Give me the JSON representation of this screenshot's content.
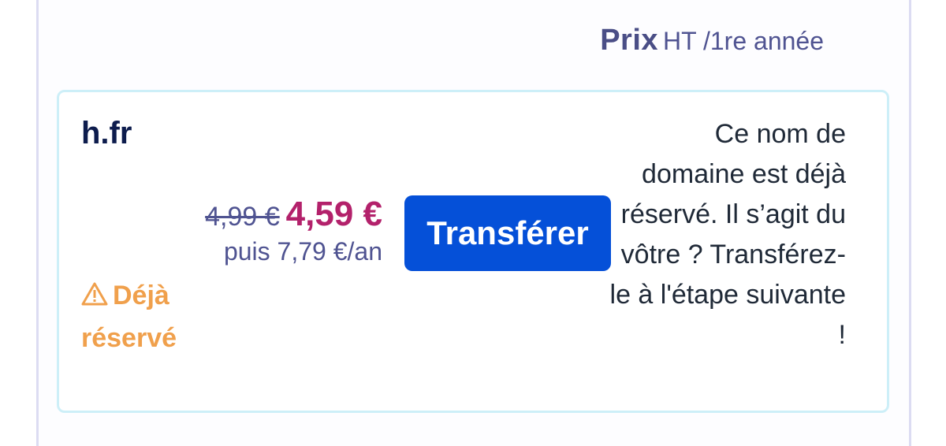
{
  "header": {
    "prix_label": "Prix",
    "ht_label": "HT /1re année"
  },
  "domain": {
    "name": "h.fr",
    "old_price": "4,99 €",
    "new_price": "4,59 €",
    "renewal": "puis 7,79 €/an",
    "button_label": "Transférer",
    "status_line1": "Déjà",
    "status_line2": "réservé",
    "status_icon": "warning-triangle-icon",
    "status_color": "#f0a04c",
    "info_text": "Ce nom de domaine est déjà réservé. Il s’agit du vôtre ? Transférez-le à l'étape suivante !"
  },
  "colors": {
    "accent_button": "#0550d8",
    "price_highlight": "#b3216b",
    "card_border": "#cdeff8"
  }
}
